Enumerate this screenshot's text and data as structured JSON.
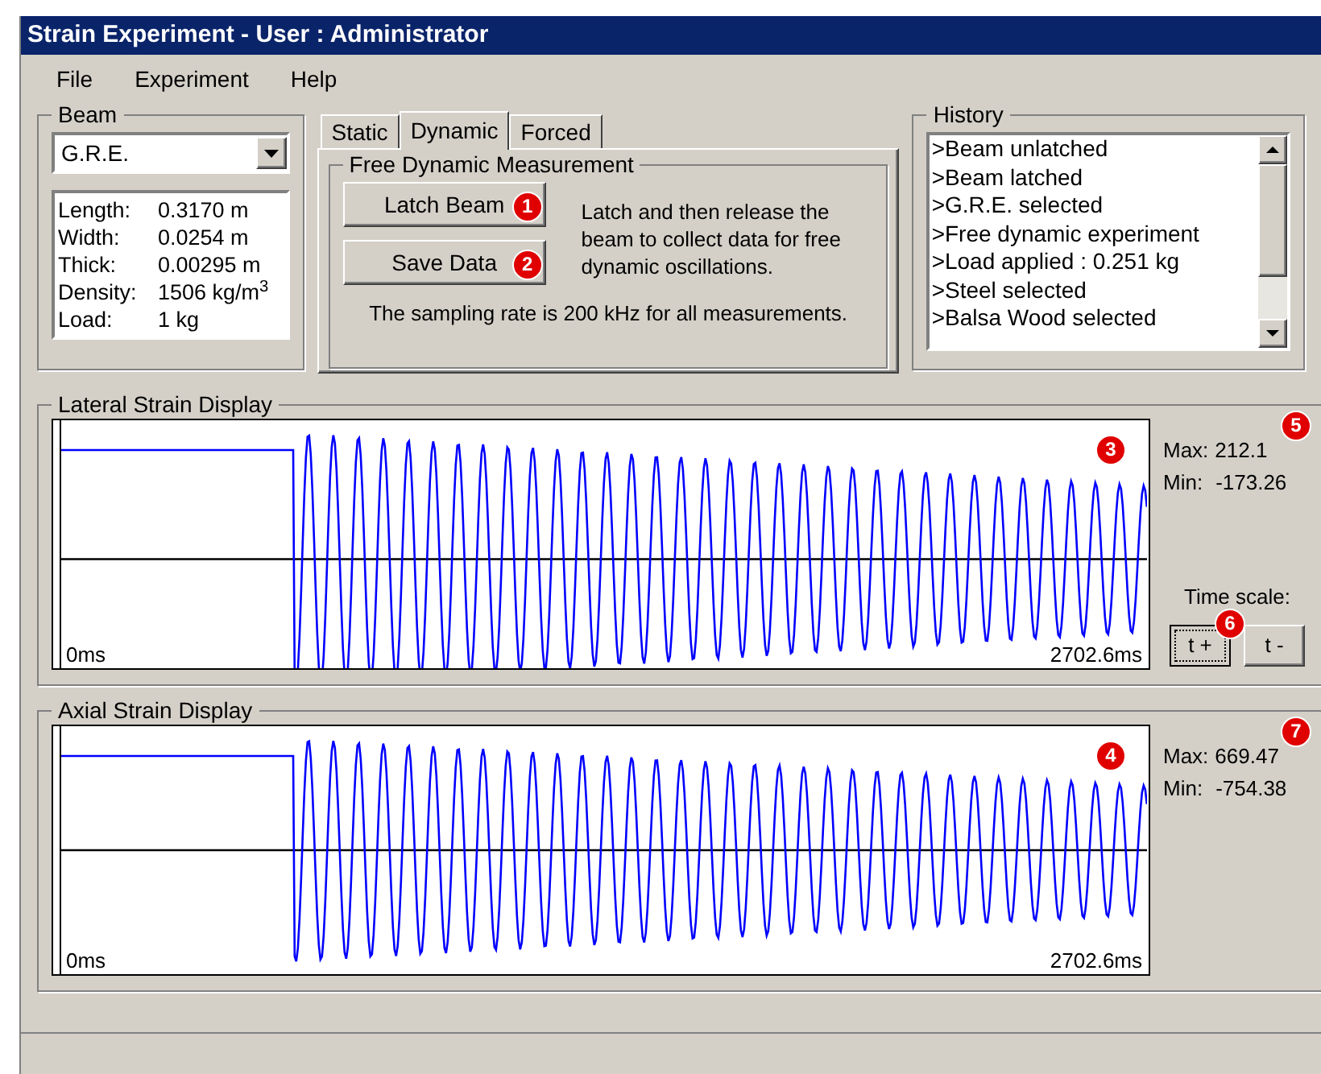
{
  "window": {
    "title": "Strain Experiment - User : Administrator"
  },
  "menu": [
    "File",
    "Experiment",
    "Help"
  ],
  "beam": {
    "label": "Beam",
    "material": "G.R.E.",
    "properties": [
      {
        "name": "Length:",
        "value": "0.3170 m"
      },
      {
        "name": "Width:",
        "value": "0.0254 m"
      },
      {
        "name": "Thick:",
        "value": "0.00295 m"
      },
      {
        "name": "Density:",
        "value": "1506 kg/m$^{3}$"
      },
      {
        "name": "Load:",
        "value": "1 kg"
      }
    ]
  },
  "tabs": [
    {
      "label": "Static",
      "selected": false
    },
    {
      "label": "Dynamic",
      "selected": true
    },
    {
      "label": "Forced",
      "selected": false
    }
  ],
  "measurement": {
    "label": "Free Dynamic Measurement",
    "buttons": [
      {
        "label": "Latch Beam",
        "marker": "1"
      },
      {
        "label": "Save Data",
        "marker": "2"
      }
    ],
    "description": "Latch and then release the beam to collect data for free dynamic oscillations.",
    "note": "The sampling rate is 200 kHz for all measurements."
  },
  "history": {
    "label": "History",
    "entries": [
      ">Beam unlatched",
      ">Beam latched",
      ">G.R.E. selected",
      ">Free dynamic experiment",
      ">Load applied : 0.251 kg",
      ">Steel selected",
      ">Balsa Wood selected"
    ]
  },
  "displays": [
    {
      "label": "Lateral Strain Display",
      "marker": "3",
      "start": "0ms",
      "end": "2702.6ms",
      "max_label": "Max:",
      "max": "212.1",
      "min_label": "Min:",
      "min": "-173.26",
      "stats_marker": "5",
      "time_scale": {
        "label": "Time scale:",
        "marker": "6",
        "buttons": [
          {
            "label": "t +",
            "focused": true
          },
          {
            "label": "t -",
            "focused": false
          }
        ]
      }
    },
    {
      "label": "Axial Strain Display",
      "marker": "4",
      "start": "0ms",
      "end": "2702.6ms",
      "max_label": "Max:",
      "max": "669.47",
      "min_label": "Min:",
      "min": "-754.38",
      "stats_marker": "7"
    }
  ]
}
